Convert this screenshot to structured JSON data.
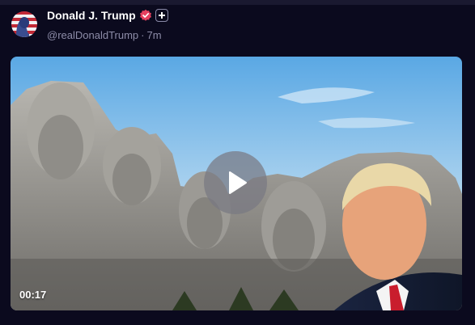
{
  "post": {
    "author_name": "Donald J. Trump",
    "handle": "@realDonaldTrump",
    "separator": "·",
    "time_ago": "7m"
  },
  "video": {
    "duration": "00:17"
  },
  "icons": {
    "verified": "verified-badge-icon",
    "plus": "plus-badge-icon",
    "play": "play-icon"
  },
  "colors": {
    "background": "#0b0a1e",
    "verified_badge": "#e5405e",
    "secondary_text": "#8d8ca8"
  }
}
